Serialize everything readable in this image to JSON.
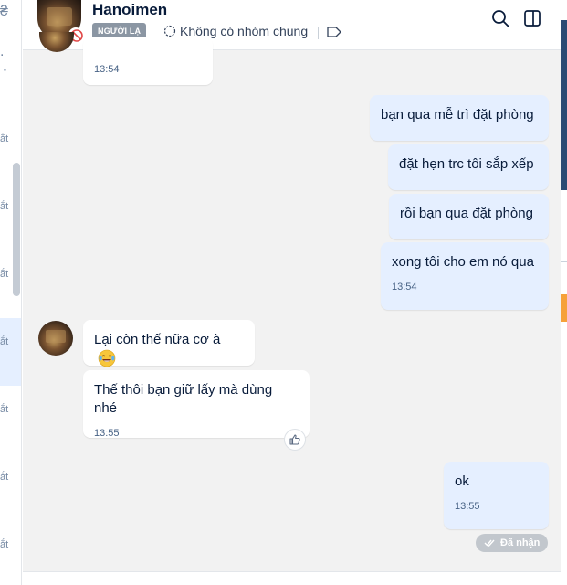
{
  "header": {
    "contact_name": "Hanoimen",
    "stranger_tag": "NGƯỜI LẠ",
    "common_groups_label": "Không có nhóm chung",
    "icons": [
      "search-icon",
      "panel-toggle-icon",
      "tag-icon",
      "group-icon",
      "blocked-icon"
    ]
  },
  "left_list": {
    "partial_labels": [
      "ắt",
      "ắt",
      "ắt",
      "ắt",
      "ắt",
      "ắt",
      "ắt"
    ]
  },
  "messages": [
    {
      "side": "received",
      "text": "",
      "time": "13:54"
    },
    {
      "side": "sent",
      "text": "bạn qua mễ trì đặt phòng",
      "time": ""
    },
    {
      "side": "sent",
      "text": "đặt hẹn trc tôi sắp xếp",
      "time": ""
    },
    {
      "side": "sent",
      "text": "rồi bạn qua đặt phòng",
      "time": ""
    },
    {
      "side": "sent",
      "text": "xong tôi cho em nó qua",
      "time": "13:54"
    },
    {
      "side": "received",
      "text": "Lại còn thế nữa cơ à",
      "time": "",
      "emoji": "laughing-tears-emoji"
    },
    {
      "side": "received",
      "text": "Thế thôi bạn giữ lấy mà dùng nhé",
      "time": "13:55"
    },
    {
      "side": "sent",
      "text": "ok",
      "time": "13:55"
    }
  ],
  "status": {
    "received_label": "Đã nhận"
  },
  "colors": {
    "sent_bubble": "#e5efff",
    "received_bubble": "#ffffff",
    "chat_bg": "#f2f2f2",
    "text": "#081b3a"
  }
}
